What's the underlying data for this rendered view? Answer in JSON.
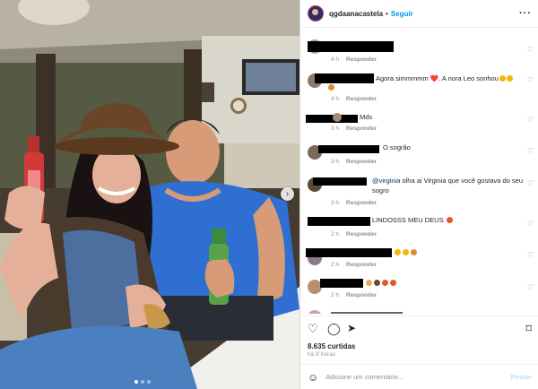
{
  "header": {
    "username": "qgdaanacastela",
    "separator": "•",
    "follow_label": "Seguir",
    "more_icon": "more-horizontal-icon"
  },
  "comments": [
    {
      "text": "",
      "meta_time": "4 h",
      "reply": "Responder"
    },
    {
      "text": "Agora simmmmm ❤️. A nora Leo sonhou",
      "meta_time": "4 h",
      "reply": "Responder",
      "emoji_colors": [
        "#f2b705",
        "#f2b705"
      ]
    },
    {
      "text": "Mds",
      "meta_time": "3 h",
      "reply": "Responder"
    },
    {
      "text": "O sogrão",
      "meta_time": "3 h",
      "reply": "Responder"
    },
    {
      "mention": "@virginia",
      "text": "olha ai Virginia que você gostava do seu sogro",
      "meta_time": "3 h",
      "reply": "Responder"
    },
    {
      "text": "LINDOSSS MEU DEUS",
      "meta_time": "2 h",
      "reply": "Responder"
    },
    {
      "text": "",
      "meta_time": "2 h",
      "reply": "Responder"
    },
    {
      "text": "",
      "meta_time": "2 h",
      "reply": "Responder"
    },
    {
      "text": "",
      "meta_time": "",
      "reply": ""
    }
  ],
  "actions": {
    "likes": "8.635 curtidas",
    "time": "há 9 horas"
  },
  "add_comment": {
    "placeholder": "Adicione um comentário...",
    "post_label": "Postar"
  },
  "colors": {
    "link": "#0095f6",
    "muted": "#8e8e8e",
    "text": "#262626"
  }
}
